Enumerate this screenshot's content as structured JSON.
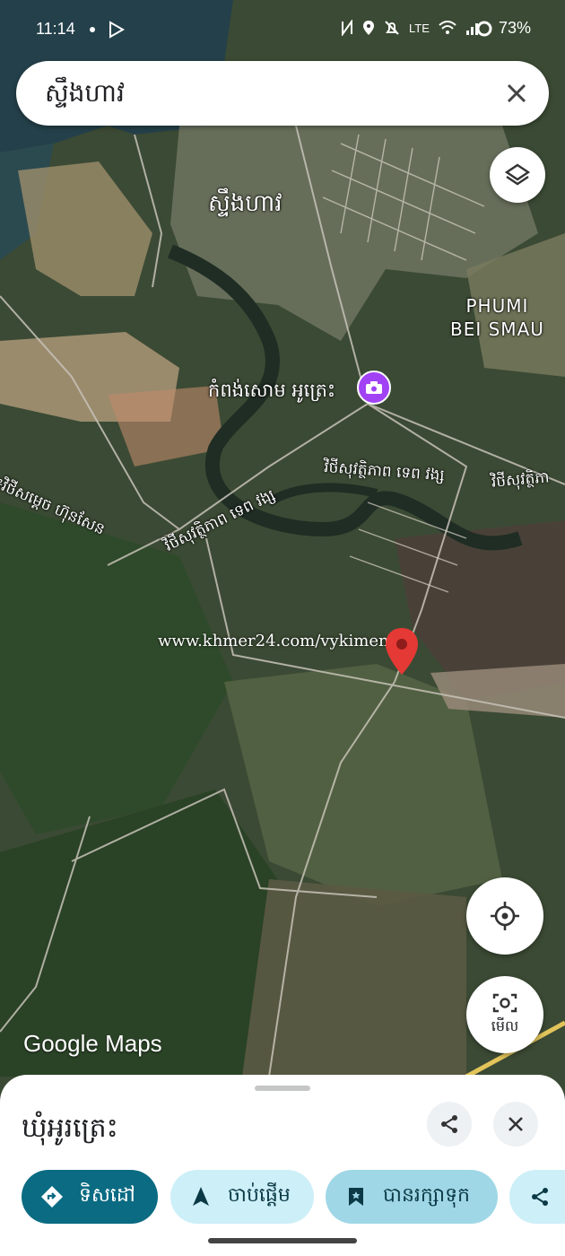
{
  "status_bar": {
    "time": "11:14",
    "battery": "73%",
    "lte": "LTE"
  },
  "search": {
    "query": "ស្ទឹងហាវ"
  },
  "map": {
    "labels": {
      "town": "ស្ទឹងហាវ",
      "phumi_line1": "PHUMI",
      "phumi_line2": "BEI SMAU",
      "poi": "កំពង់សោម អូត្រេះ",
      "road_a": "វិថីសុវត្ថិភាព ទេព វង្ស",
      "road_a_right": "វិថីសុវត្ថិភា",
      "road_b": "វិថីសុវត្ថិភាព ទេព វង្ស",
      "road_c": "៖វិថីសម្ដេច ហ៊ុនសែន"
    },
    "watermark": "www.khmer24.com/vykimeng",
    "logo_google": "Google",
    "logo_maps": "Maps",
    "lens_label": "មើល",
    "colors": {
      "pin": "#e53935",
      "poi": "#a142f4"
    }
  },
  "sheet": {
    "place_name": "ឃុំអូរត្រេះ",
    "chips": {
      "directions": "ទិសដៅ",
      "start": "ចាប់ផ្ដើម",
      "saved": "បានរក្សាទុក",
      "share": "ច"
    }
  }
}
